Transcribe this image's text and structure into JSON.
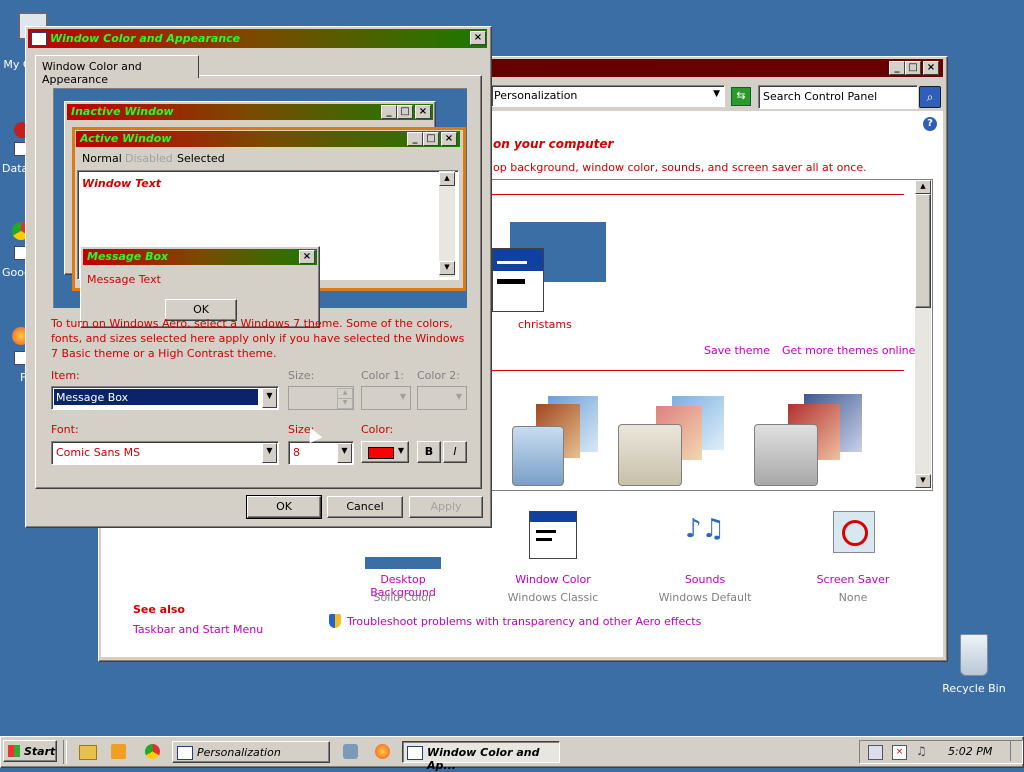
{
  "desktop": {
    "icons": [
      {
        "label": "My C"
      },
      {
        "label": "Data"
      },
      {
        "label": "Goog"
      },
      {
        "label": "F"
      },
      {
        "label": "Recycle Bin"
      }
    ]
  },
  "personalization": {
    "address": "Personalization",
    "search_placeholder": "Search Control Panel",
    "heading": "on your computer",
    "subheading": "op background, window color, sounds, and screen saver all at once.",
    "theme_name": "christams",
    "save_theme": "Save theme",
    "get_more_themes": "Get more themes online",
    "bottom_items": [
      {
        "label": "Desktop Background",
        "sub": "Solid Color"
      },
      {
        "label": "Window Color",
        "sub": "Windows Classic"
      },
      {
        "label": "Sounds",
        "sub": "Windows Default"
      },
      {
        "label": "Screen Saver",
        "sub": "None"
      }
    ],
    "see_also": "See also",
    "taskbar_link": "Taskbar and Start Menu",
    "troubleshoot": "Troubleshoot problems with transparency and other Aero effects"
  },
  "dialog": {
    "title": "Window Color and Appearance",
    "tab": "Window Color and Appearance",
    "preview": {
      "inactive_title": "Inactive Window",
      "active_title": "Active Window",
      "menu": [
        "Normal",
        "Disabled",
        "Selected"
      ],
      "window_text": "Window Text",
      "msgbox_title": "Message Box",
      "msgbox_text": "Message Text",
      "ok": "OK"
    },
    "info_text": "To turn on Windows Aero, select a Windows 7 theme.  Some of the colors, fonts, and sizes selected here apply only if you have selected the Windows 7 Basic theme or a High Contrast theme.",
    "item_label": "Item:",
    "item_value": "Message Box",
    "size_label": "Size:",
    "color1_label": "Color 1:",
    "color2_label": "Color 2:",
    "font_label": "Font:",
    "font_value": "Comic Sans MS",
    "font_size_label": "Size:",
    "font_size_value": "8",
    "color_label": "Color:",
    "bold": "B",
    "italic": "I",
    "ok": "OK",
    "cancel": "Cancel",
    "apply": "Apply"
  },
  "taskbar": {
    "start": "Start",
    "tasks": [
      "Personalization",
      "Window Color and Ap..."
    ],
    "clock": "5:02 PM"
  },
  "colors": {
    "desktop": "#3b6ea5",
    "text_color_selected": "#ff0000",
    "link": "#c000c0",
    "accent_red": "#d00000"
  }
}
